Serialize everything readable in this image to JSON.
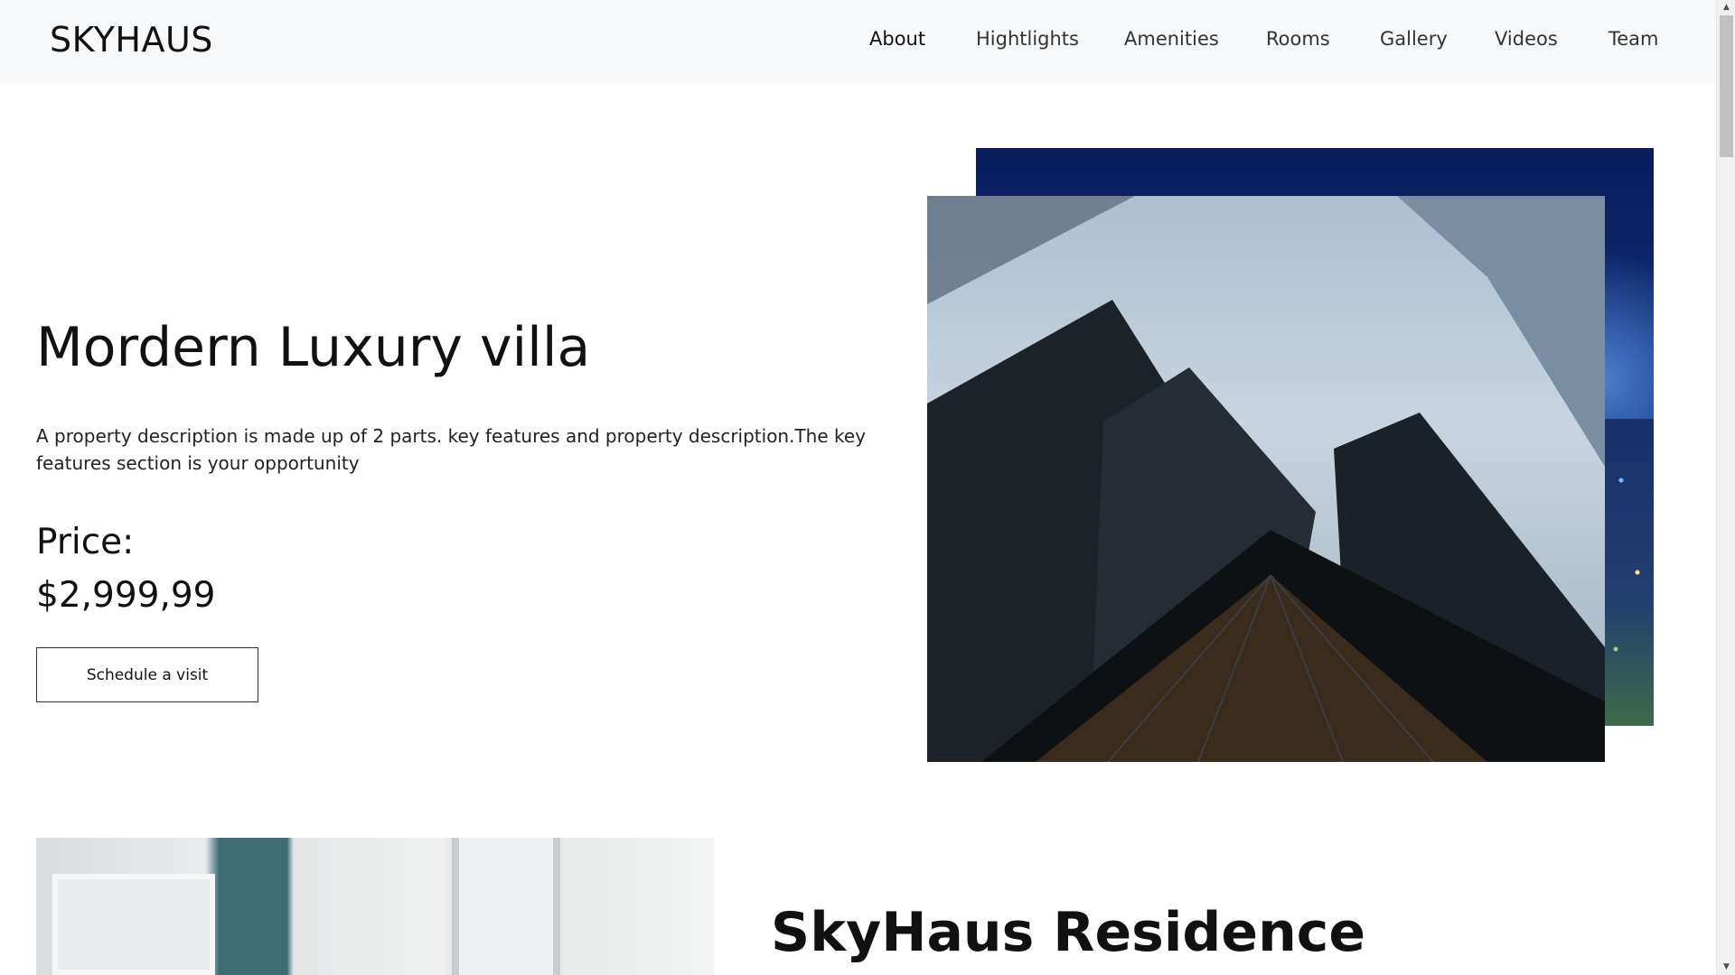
{
  "header": {
    "brand": "SKYHAUS",
    "nav": [
      {
        "label": "About",
        "active": true
      },
      {
        "label": "Hightlights"
      },
      {
        "label": "Amenities"
      },
      {
        "label": "Rooms"
      },
      {
        "label": "Gallery"
      },
      {
        "label": "Videos"
      },
      {
        "label": "Team"
      }
    ]
  },
  "hero": {
    "title": "Mordern Luxury villa",
    "description": "A property description is made up of 2 parts. key features and property description.The key features section is your opportunity",
    "price_label": "Price:",
    "price_value": "$2,999,99",
    "cta_label": "Schedule a visit"
  },
  "residence": {
    "title": "SkyHaus Residence"
  },
  "scrollbar": {
    "up_icon": "▲",
    "down_icon": "▼"
  },
  "colors": {
    "header_bg": "#f7f8f9",
    "text": "#111111",
    "night_sky": "#0f2f7a"
  }
}
